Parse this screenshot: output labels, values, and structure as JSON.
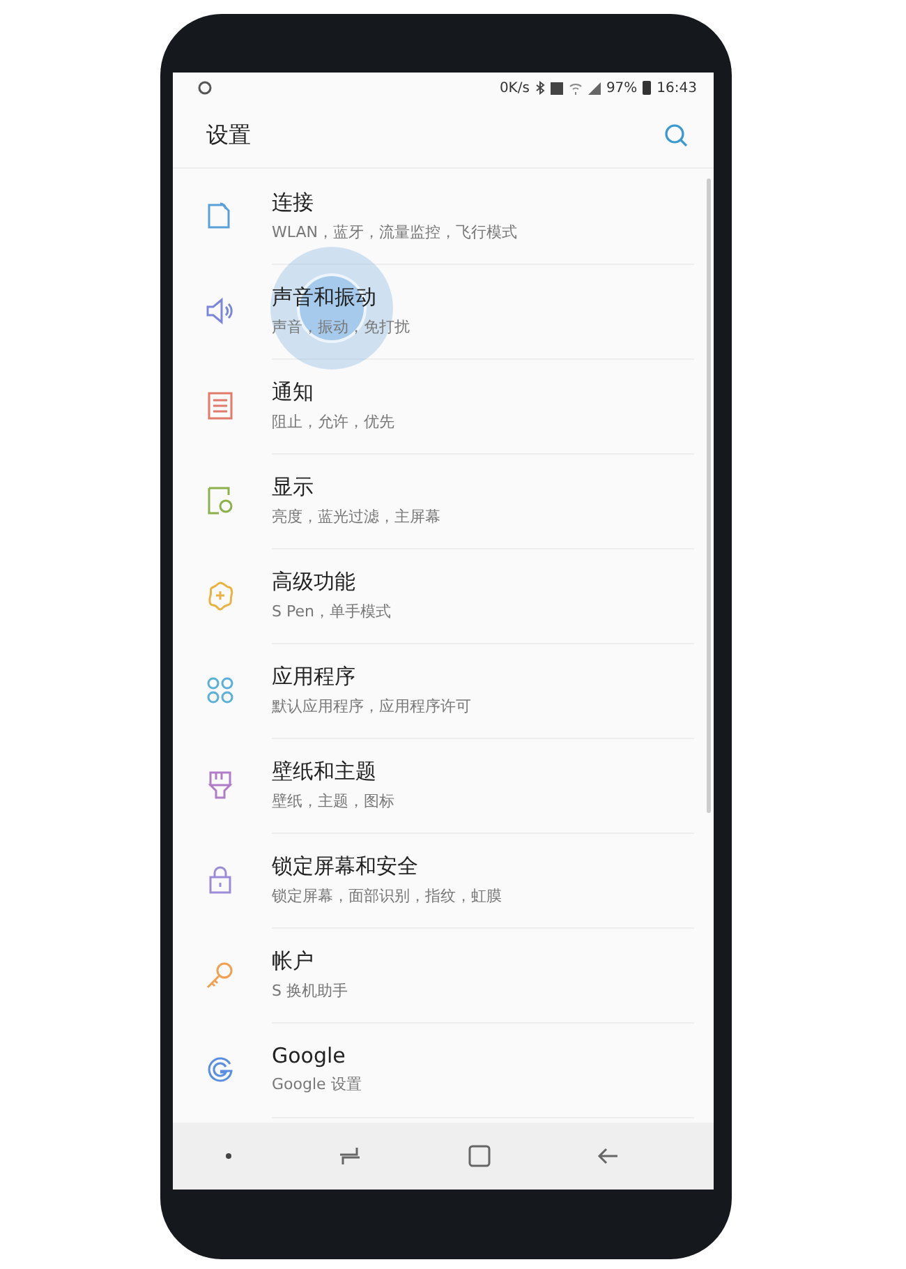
{
  "status_bar": {
    "speed": "0K/s",
    "battery": "97%",
    "time": "16:43"
  },
  "header": {
    "title": "设置"
  },
  "items": [
    {
      "kind": "connections",
      "color": "#5aa0d8",
      "title": "连接",
      "subtitle": "WLAN，蓝牙，流量监控，飞行模式"
    },
    {
      "kind": "sound",
      "color": "#7c86d8",
      "title": "声音和振动",
      "subtitle": "声音，振动，免打扰"
    },
    {
      "kind": "notifications",
      "color": "#e07a6a",
      "title": "通知",
      "subtitle": "阻止，允许，优先"
    },
    {
      "kind": "display",
      "color": "#8cb04a",
      "title": "显示",
      "subtitle": "亮度，蓝光过滤，主屏幕"
    },
    {
      "kind": "advanced",
      "color": "#e8b340",
      "title": "高级功能",
      "subtitle": "S Pen，单手模式"
    },
    {
      "kind": "apps",
      "color": "#5ab0d8",
      "title": "应用程序",
      "subtitle": "默认应用程序，应用程序许可"
    },
    {
      "kind": "wallpaper",
      "color": "#b07cc8",
      "title": "壁纸和主题",
      "subtitle": "壁纸，主题，图标"
    },
    {
      "kind": "lock",
      "color": "#9c8cd8",
      "title": "锁定屏幕和安全",
      "subtitle": "锁定屏幕，面部识别，指纹，虹膜"
    },
    {
      "kind": "accounts",
      "color": "#f0a050",
      "title": "帐户",
      "subtitle": "S 换机助手"
    },
    {
      "kind": "google",
      "color": "#5a8ee0",
      "title": "Google",
      "subtitle": "Google 设置"
    }
  ]
}
